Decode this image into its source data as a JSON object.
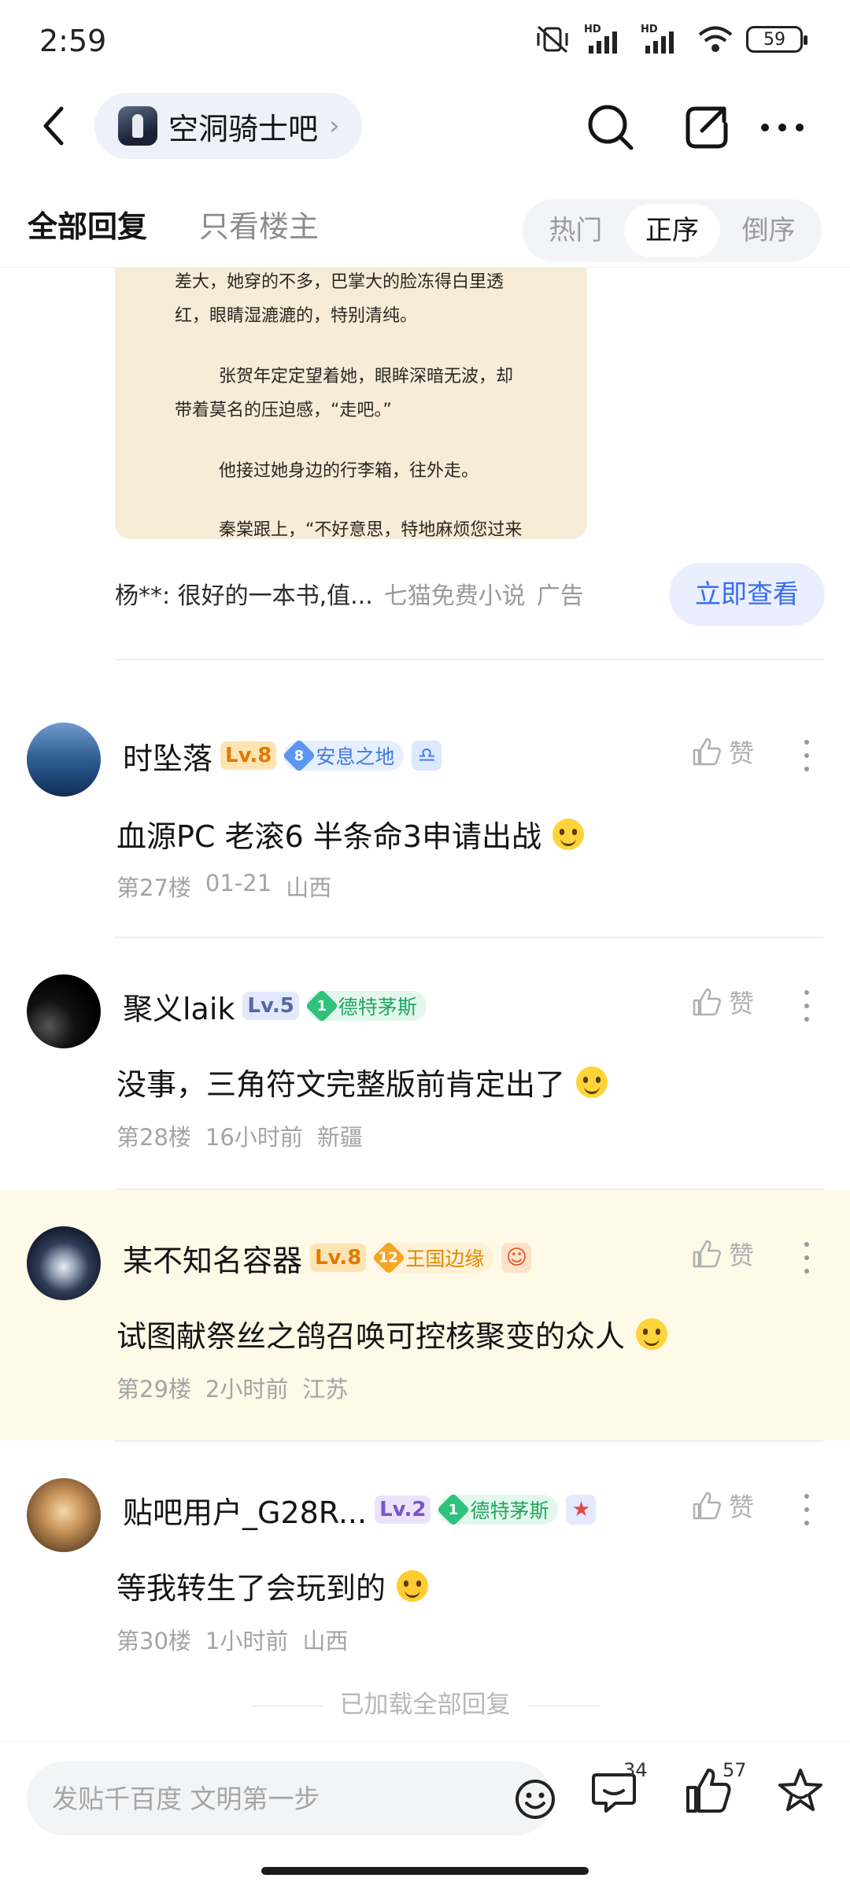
{
  "status_bar": {
    "time": "2:59",
    "battery": "59",
    "hd1": "HD",
    "hd2": "HD"
  },
  "header": {
    "forum_name": "空洞骑士吧"
  },
  "tabs": {
    "all_replies": "全部回复",
    "op_only": "只看楼主",
    "sort": [
      "热门",
      "正序",
      "倒序"
    ]
  },
  "ad": {
    "image_lines": [
      "差大，她穿的不多，巴掌大的脸冻得白里透",
      "红，眼睛湿漉漉的，特别清纯。",
      "张贺年定定望着她，眼眸深暗无波，却",
      "带着莫名的压迫感，“走吧。”",
      "他接过她身边的行李箱，往外走。",
      "秦棠跟上，“不好意思，特地麻烦您过来"
    ],
    "caption": "杨**: 很好的一本书,值...",
    "source": "七猫免费小说",
    "ad_label": "广告",
    "button": "立即查看"
  },
  "comments": [
    {
      "username": "时坠落",
      "level": "Lv.8",
      "tag_num": "8",
      "tag_text": "安息之地",
      "text": "血源PC 老滚6 半条命3申请出战",
      "floor": "第27楼",
      "time": "01-21",
      "location": "山西",
      "like_label": "赞"
    },
    {
      "username": "聚义laik",
      "level": "Lv.5",
      "tag_num": "1",
      "tag_text": "德特茅斯",
      "text": "没事，三角符文完整版前肯定出了",
      "floor": "第28楼",
      "time": "16小时前",
      "location": "新疆",
      "like_label": "赞"
    },
    {
      "username": "某不知名容器",
      "level": "Lv.8",
      "tag_num": "12",
      "tag_text": "王国边缘",
      "text": "试图献祭丝之鸽召唤可控核聚变的众人",
      "floor": "第29楼",
      "time": "2小时前",
      "location": "江苏",
      "like_label": "赞"
    },
    {
      "username": "贴吧用户_G28R...",
      "level": "Lv.2",
      "tag_num": "1",
      "tag_text": "德特茅斯",
      "text": "等我转生了会玩到的",
      "floor": "第30楼",
      "time": "1小时前",
      "location": "山西",
      "like_label": "赞"
    }
  ],
  "loaded_all": "已加载全部回复",
  "bottom_bar": {
    "input_placeholder": "发贴千百度 文明第一步",
    "comment_count": "34",
    "like_count": "57"
  },
  "colors": {
    "accent_blue": "#3a6cf0",
    "highlight_bg": "#fff9e8"
  }
}
